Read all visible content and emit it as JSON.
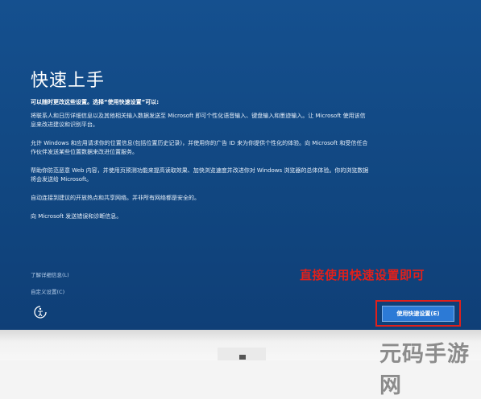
{
  "setup": {
    "title": "快速上手",
    "subhead": "可以随时更改这些设置。选择“使用快速设置”可以:",
    "paragraphs": [
      "将联系人和日历详细信息以及其他相关输入数据发送至 Microsoft 即可个性化语音输入、键盘输入和墨迹输入。让 Microsoft 使用该信息来改进建议和识别平台。",
      "允许 Windows 和应用请求你的位置信息(包括位置历史记录)，并使用你的广告 ID 来为你提供个性化的体验。向 Microsoft 和受信任合作伙伴发送某些位置数据来改进位置服务。",
      "帮助你防范恶意 Web 内容，并使用页预测功能来提高读取效果、加快浏览速度并改进你对 Windows 浏览器的总体体验。你的浏览数据将会发送给 Microsoft。",
      "自动连接到建议的开放热点和共享网络。并非所有网络都是安全的。",
      "向 Microsoft 发送错误和诊断信息。"
    ],
    "learn_more_link": "了解详细信息(L)",
    "customize_link": "自定义设置(C)",
    "express_button": "使用快速设置(E)"
  },
  "annotation": {
    "text": "直接使用快速设置即可",
    "color": "#e1201b"
  },
  "watermark": {
    "text": "元码手游网"
  },
  "icons": {
    "accessibility": "ease-of-access-icon"
  },
  "colors": {
    "background": "#134a86",
    "button": "#2c7ad6",
    "highlight": "#e1201b"
  }
}
